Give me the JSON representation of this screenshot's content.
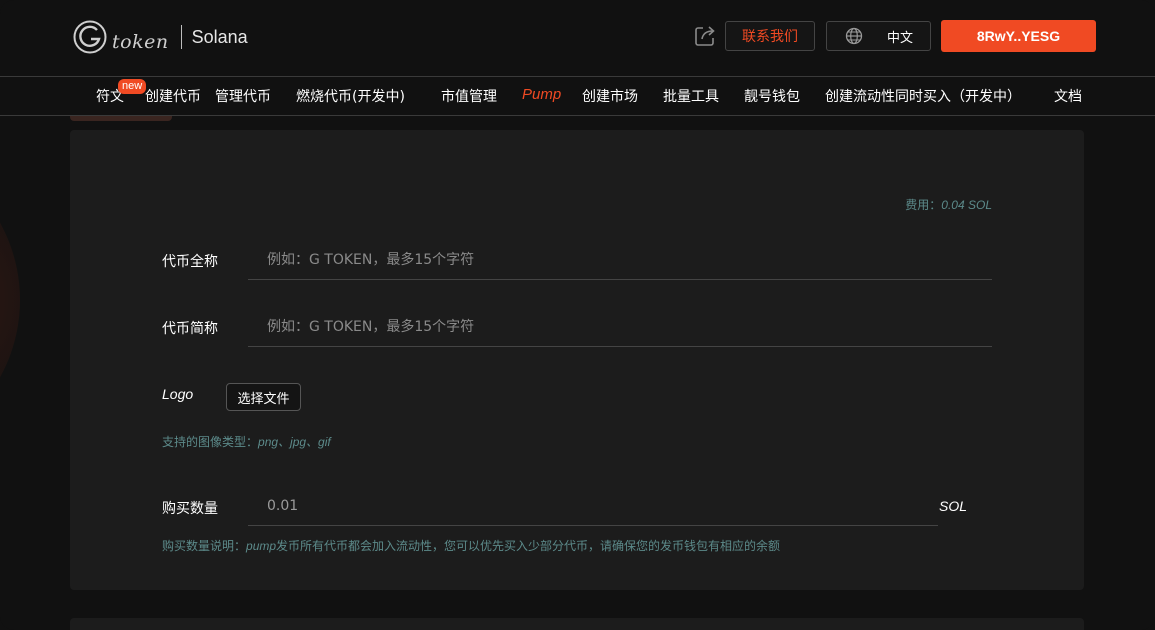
{
  "header": {
    "logo_text": "token",
    "chain": "Solana",
    "contact_label": "联系我们",
    "lang_label": "中文",
    "wallet_label": "8RwY..YESG"
  },
  "nav": {
    "badge": "new",
    "items": [
      {
        "label": "符文"
      },
      {
        "label": "创建代币"
      },
      {
        "label": "管理代币"
      },
      {
        "label": "燃烧代币(开发中)"
      },
      {
        "label": "市值管理"
      },
      {
        "label": "Pump"
      },
      {
        "label": "创建市场"
      },
      {
        "label": "批量工具"
      },
      {
        "label": "靓号钱包"
      },
      {
        "label": "创建流动性同时买入（开发中）"
      },
      {
        "label": "文档"
      }
    ]
  },
  "form": {
    "fee_label": "费用：",
    "fee_value": "0.04 SOL",
    "name_label": "代币全称",
    "name_placeholder": "例如：G TOKEN，最多15个字符",
    "symbol_label": "代币简称",
    "symbol_placeholder": "例如：G TOKEN，最多15个字符",
    "logo_label": "Logo",
    "file_button": "选择文件",
    "image_hint_label": "支持的图像类型：",
    "image_hint_types": "png、jpg、gif",
    "amount_label": "购买数量",
    "amount_value": "0.01",
    "amount_unit": "SOL",
    "amount_hint_label": "购买数量说明：",
    "amount_hint_pump": "pump",
    "amount_hint_text": "发币所有代币都会加入流动性，您可以优先买入少部分代币，请确保您的发币钱包有相应的余额"
  },
  "colors": {
    "accent": "#f04a23",
    "background": "#111111",
    "card": "#1c1c1c",
    "hint": "#5c8a8a"
  }
}
